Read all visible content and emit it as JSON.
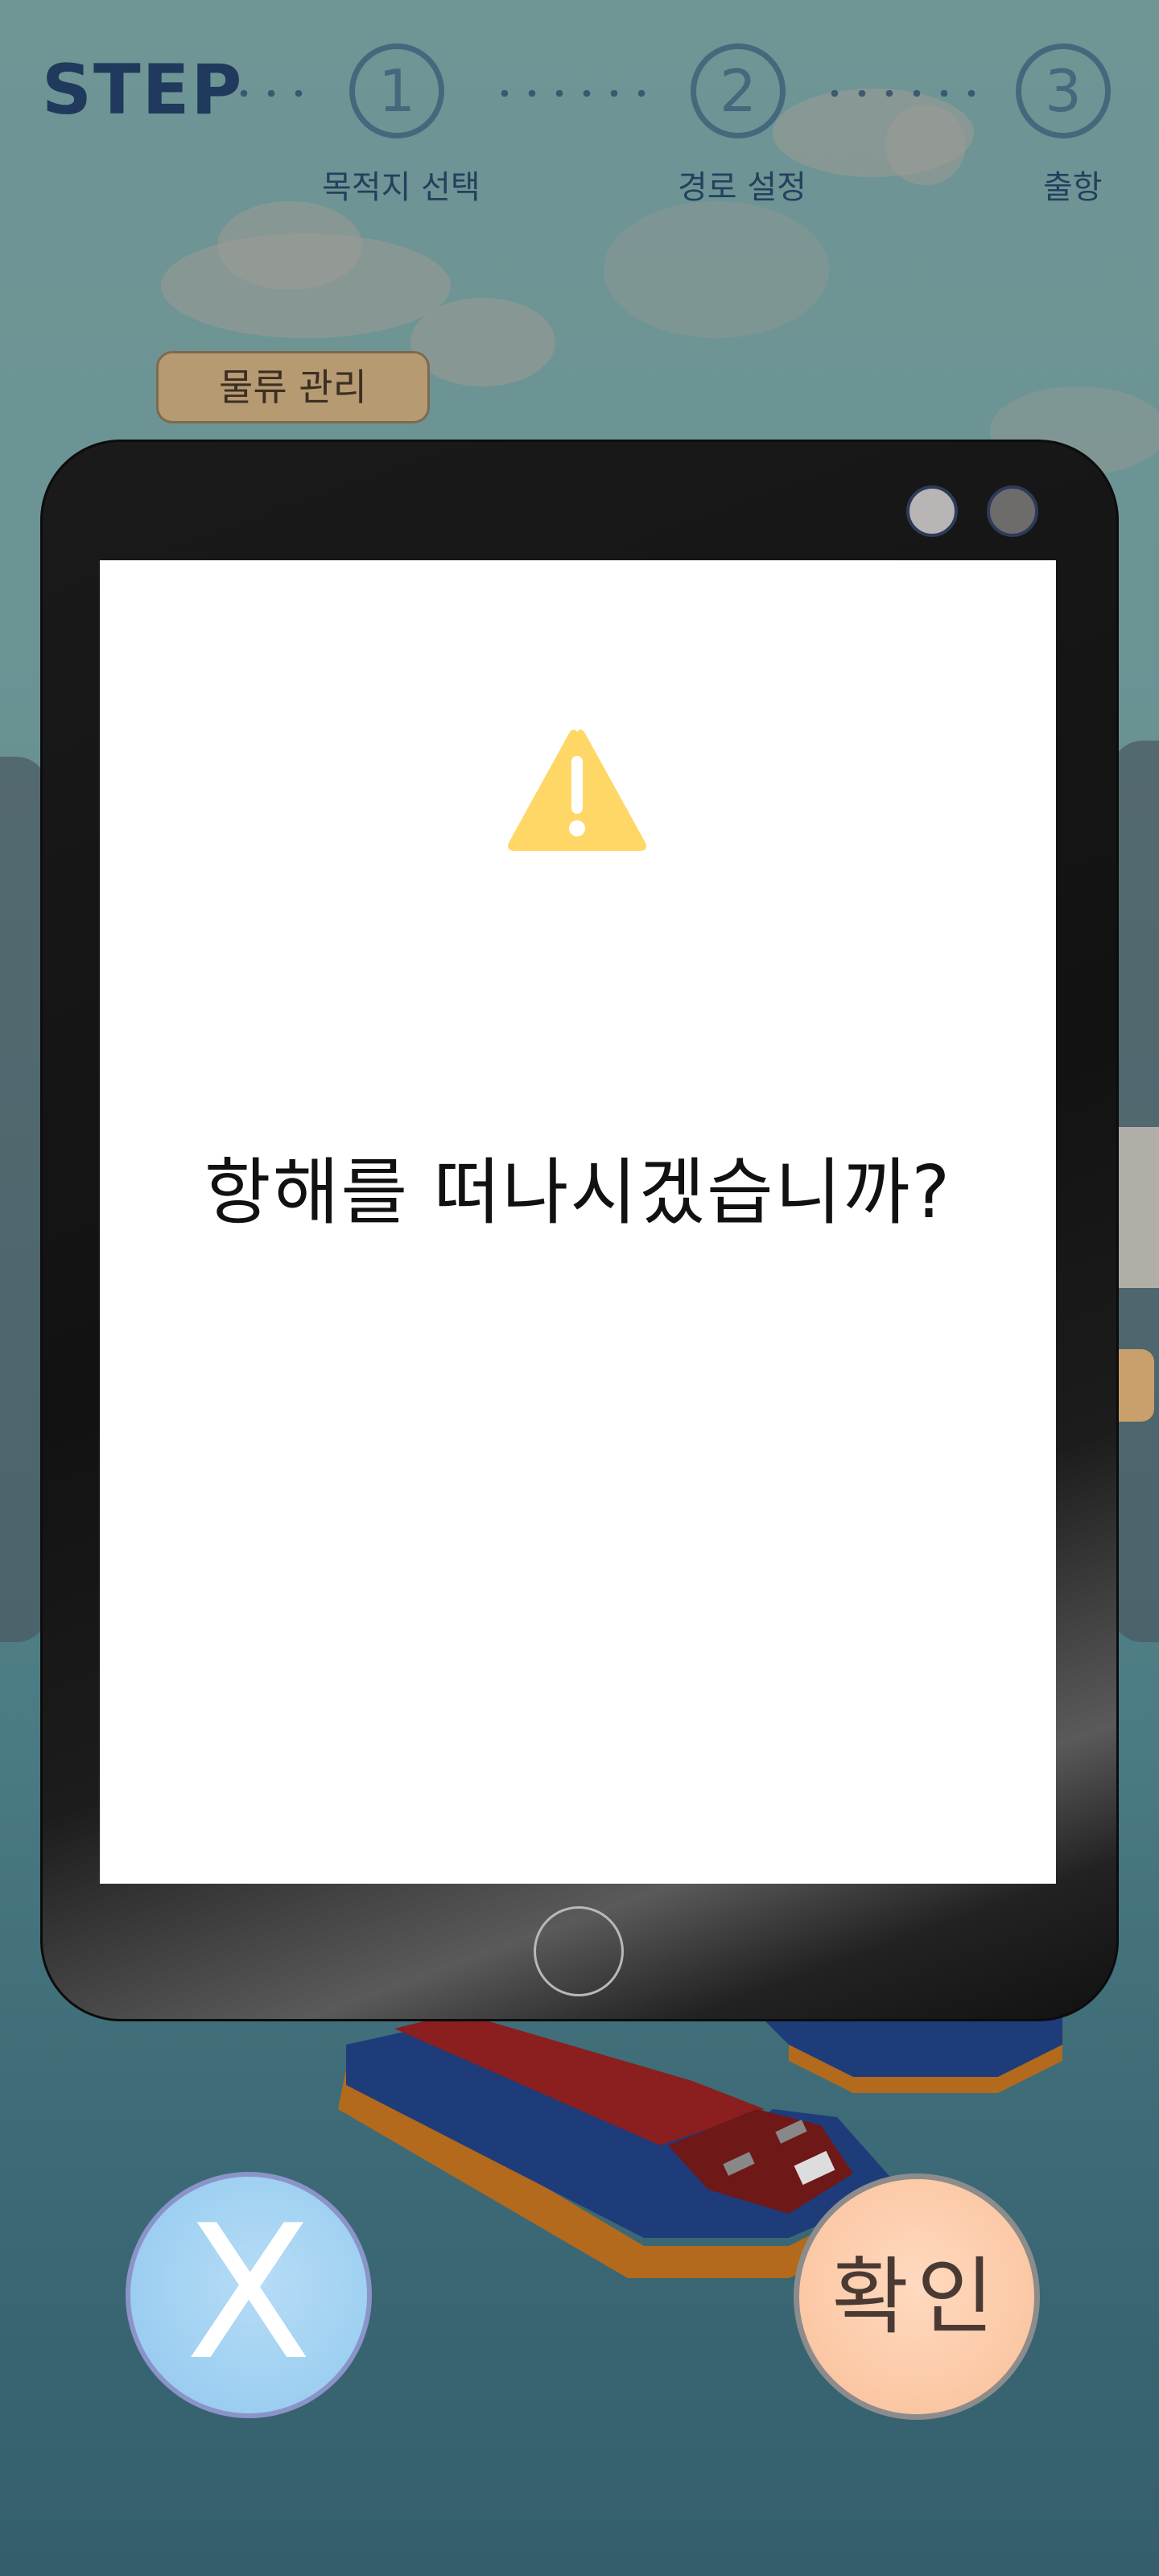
{
  "steps": {
    "word": "STEP",
    "items": [
      {
        "number": "1",
        "label": "목적지 선택"
      },
      {
        "number": "2",
        "label": "경로 설정"
      },
      {
        "number": "3",
        "label": "출항"
      }
    ]
  },
  "logistics_button": "물류 관리",
  "dialog": {
    "icon": "warning-triangle-icon",
    "message": "항해를 떠나시겠습니까?"
  },
  "actions": {
    "cancel_label": "X",
    "confirm_label": "확인"
  },
  "colors": {
    "warning": "#ffd766",
    "cancel_button": "#a3d3f3",
    "confirm_button": "#fccaa8",
    "tablet_frame": "#141414"
  }
}
